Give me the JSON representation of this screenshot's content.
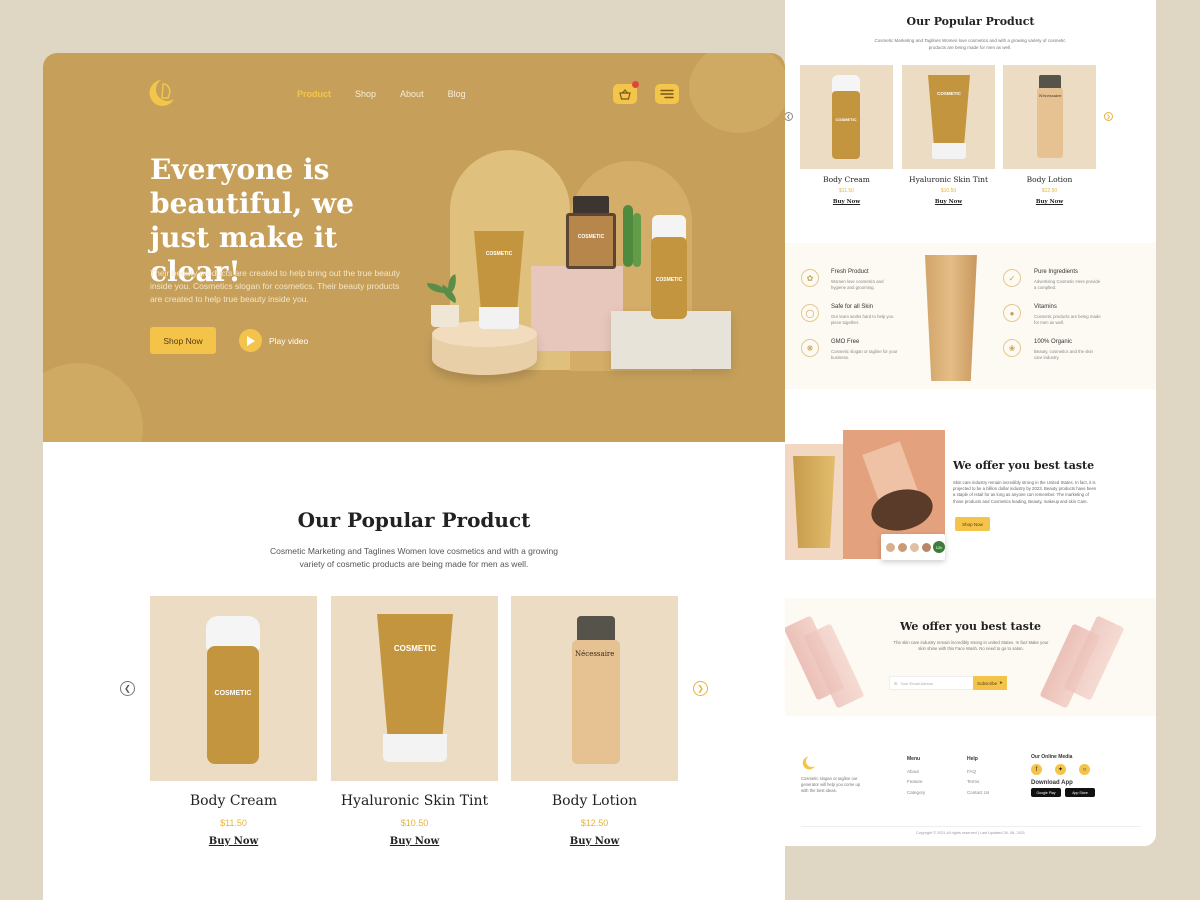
{
  "nav": {
    "items": [
      "Product",
      "Shop",
      "About",
      "Blog"
    ],
    "active": "Product"
  },
  "hero": {
    "title": "Everyone is beautiful, we just make it clear!",
    "description": "Their beauty products are created to help bring out the true beauty inside you. Cosmetics slogan for cosmetics. Their beauty products are created to help true beauty inside you.",
    "shop_button": "Shop Now",
    "play_label": "Play video",
    "tube_label": "COSMETIC",
    "bottle_label": "COSMETIC",
    "perfume_label": "COSMETIC"
  },
  "popular": {
    "title": "Our Popular Product",
    "description": "Cosmetic Marketing and Taglines Women love cosmetics and with a growing variety of cosmetic products are being made for men as well.",
    "products": [
      {
        "name": "Body Cream",
        "price": "$11.50",
        "buy": "Buy Now",
        "label": "COSMETIC"
      },
      {
        "name": "Hyaluronic Skin Tint",
        "price": "$10.50",
        "buy": "Buy Now",
        "label": "COSMETIC"
      },
      {
        "name": "Body Lotion",
        "price": "$12.50",
        "buy": "Buy Now",
        "label": "Nécessaire"
      }
    ]
  },
  "features": {
    "left": [
      {
        "title": "Fresh Product",
        "desc": "Women love cosmetics and hygiene and grooming."
      },
      {
        "title": "Safe for all Skin",
        "desc": "Our team works hard to help you piece together."
      },
      {
        "title": "GMO Free",
        "desc": "Cosmetic slogan or tagline for your business."
      }
    ],
    "right": [
      {
        "title": "Pure Ingredients",
        "desc": "Advertising Cosmetic Here provide a complted."
      },
      {
        "title": "Vitamins",
        "desc": "Cosmetic products are being made for men as well."
      },
      {
        "title": "100% Organic",
        "desc": "Beauty, cosmetics and the skin care industry."
      }
    ]
  },
  "offer": {
    "title": "We offer you best taste",
    "description": "Skin care industry remain incredibly strong in the United States. In fact, it is projected to be a billion dollar industry by 2023. Beauty products have been a staple of retail for as long as anyone can remember. The marketing of those products and Cosmetics leading, Beauty, makeup and skin Care.",
    "button": "Shop Now",
    "avatar_count": "12k"
  },
  "newsletter": {
    "title": "We offer you best taste",
    "description": "The skin care industry remain incredibly strong in united States. In fact Make your skin shine with this Face Wash. No need to go to salon.",
    "placeholder": "Your Email Adress",
    "button": "Subscribe"
  },
  "footer": {
    "description": "Cosmetic slogan or tagline our generator will help you come up with the best ideas.",
    "menu_title": "Menu",
    "menu": [
      "About",
      "Feature",
      "Category"
    ],
    "help_title": "Help",
    "help": [
      "FAQ",
      "Terms",
      "Contact Us"
    ],
    "social_title": "Our Online Media",
    "app_title": "Download App",
    "google_play": "Google Play",
    "app_store": "App Store",
    "copyright": "Copyright © 2021 All rights reserved | Last Updated 26- 08- 2021"
  },
  "colors": {
    "hero_bg": "#c6a05b",
    "accent": "#f4c44a",
    "card_bg": "#ecdcc4",
    "price": "#e5b33a"
  }
}
